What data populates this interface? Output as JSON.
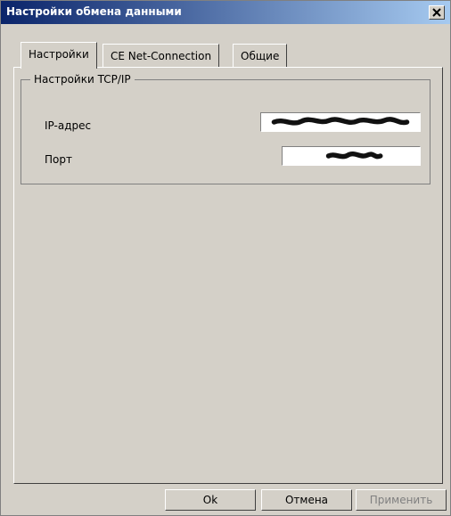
{
  "window": {
    "title": "Настройки обмена данными"
  },
  "tabs": [
    {
      "label": "Настройки",
      "active": true
    },
    {
      "label": "CE Net-Connection",
      "active": false
    },
    {
      "label": "Общие",
      "active": false
    }
  ],
  "tcp_group": {
    "title": "Настройки TCP/IP",
    "ip_label": "IP-адрес",
    "port_label": "Порт"
  },
  "buttons": {
    "ok": "Ok",
    "cancel": "Отмена",
    "apply": "Применить"
  },
  "icons": {
    "close": "close-icon",
    "redacted": "redacted-scribble-icon"
  }
}
